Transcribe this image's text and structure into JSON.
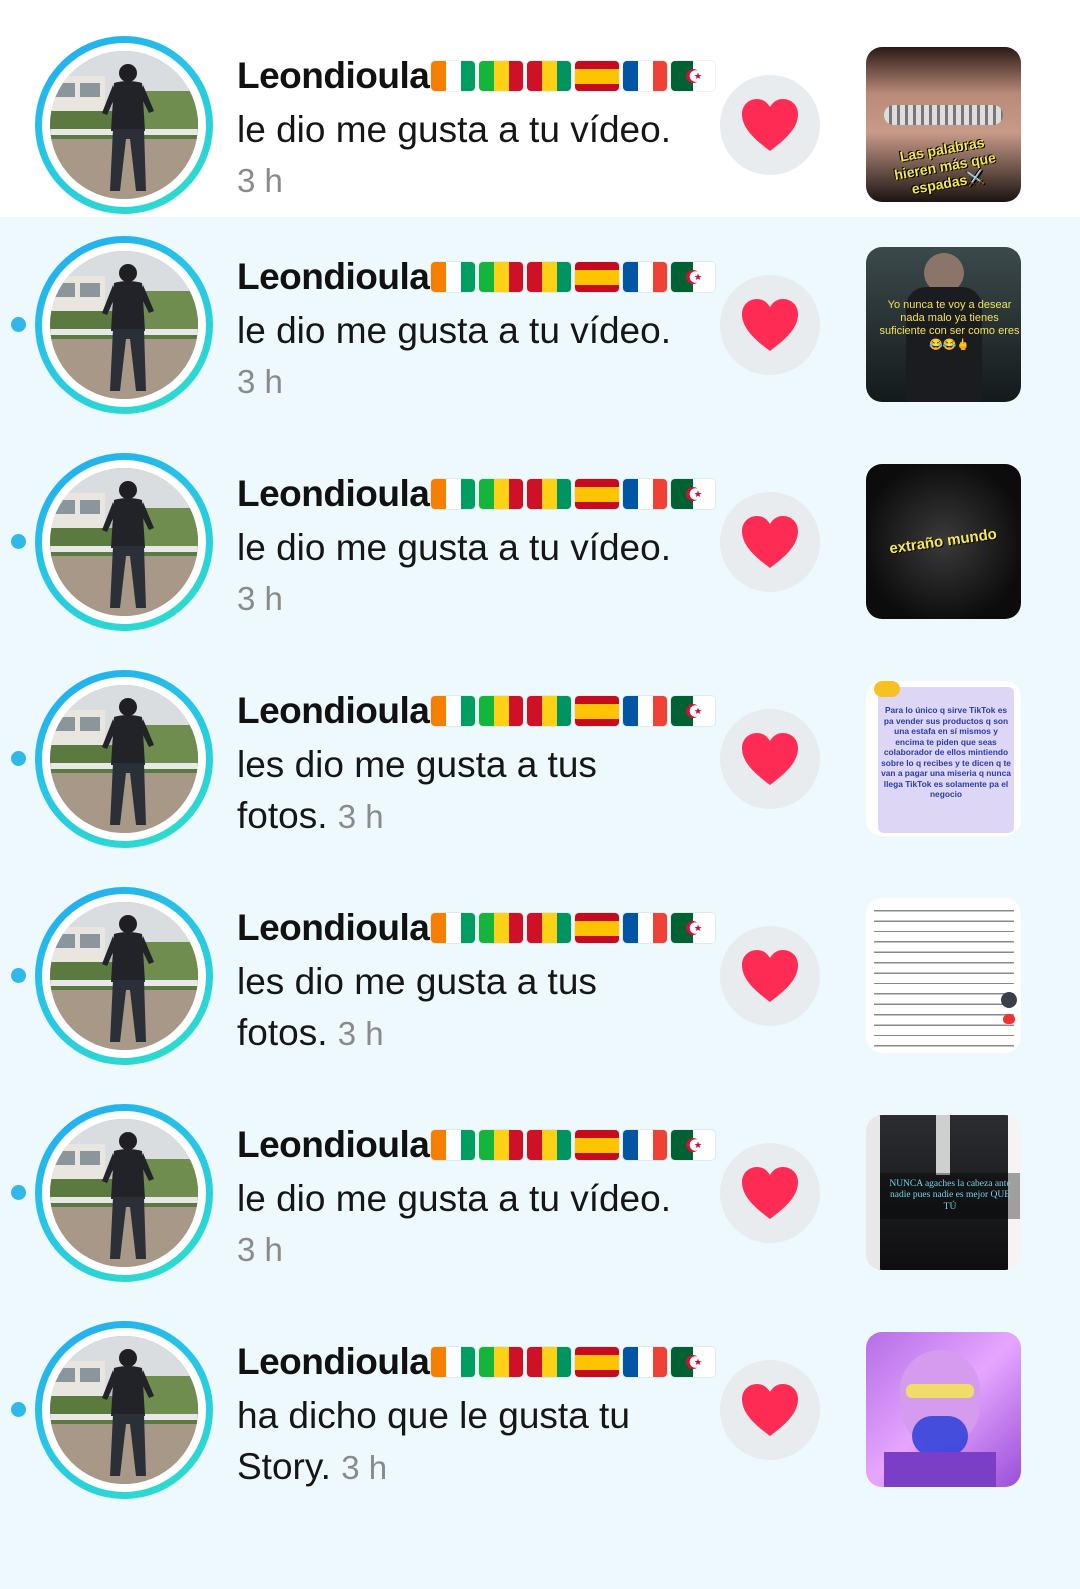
{
  "notifications": [
    {
      "username": "Leondioula",
      "action": "le dio me gusta a tu vídeo.",
      "time": "3 h",
      "unread": false,
      "thumbnail": {
        "text": "Las palabras hieren más que espadas⚔️",
        "style": "lips"
      }
    },
    {
      "username": "Leondioula",
      "action": "le dio me gusta a tu vídeo.",
      "time": "3 h",
      "unread": true,
      "thumbnail": {
        "text": "Yo nunca te voy a desear nada malo ya tienes suficiente con ser como eres 😂😂🖕",
        "style": "dark-man"
      }
    },
    {
      "username": "Leondioula",
      "action": "le dio me gusta a tu vídeo.",
      "time": "3 h",
      "unread": true,
      "thumbnail": {
        "text": "extraño mundo",
        "style": "dark"
      }
    },
    {
      "username": "Leondioula",
      "action": "les dio me gusta a tus fotos.",
      "time": "3 h",
      "unread": true,
      "thumbnail": {
        "text": "Para lo único q sirve TikTok es pa vender sus productos q son una estafa en sí mismos y encima te piden que seas colaborador de ellos mintiendo sobre lo q recibes y te dicen q te van a pagar una miseria q nunca llega TikTok es solamente pa el negocio",
        "style": "note"
      }
    },
    {
      "username": "Leondioula",
      "action": "les dio me gusta a tus fotos.",
      "time": "3 h",
      "unread": true,
      "thumbnail": {
        "text": "",
        "style": "text-page"
      }
    },
    {
      "username": "Leondioula",
      "action": "le dio me gusta a tu vídeo.",
      "time": "3 h",
      "unread": true,
      "thumbnail": {
        "text": "NUNCA agaches la cabeza ante nadie pues nadie es mejor QUE TÚ",
        "style": "suit"
      }
    },
    {
      "username": "Leondioula",
      "action": "ha dicho que le gusta tu Story.",
      "time": "3 h",
      "unread": true,
      "thumbnail": {
        "text": "",
        "style": "purple"
      }
    }
  ],
  "colors": {
    "unread_bg": "#edf9fc",
    "unread_dot": "#2fb8e8",
    "heart": "#fe2c55",
    "ring_start": "#23a9f0",
    "ring_end": "#2ee0c8"
  },
  "icons": {
    "like": "heart-icon",
    "flags": [
      "ivory-coast-flag",
      "mali-flag",
      "guinea-flag",
      "spain-flag",
      "france-flag",
      "algeria-flag"
    ]
  }
}
